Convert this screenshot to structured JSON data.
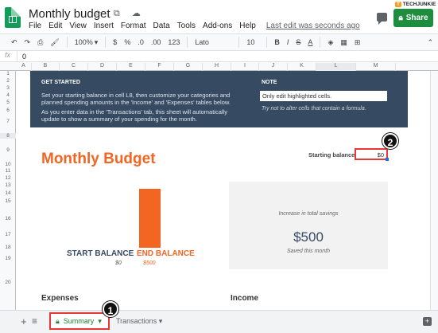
{
  "brand": {
    "prefix": "T",
    "name": "TECHJUNKIE"
  },
  "title": "Monthly budget",
  "title_icons": "☆ ⧉ ☁",
  "menu": [
    "File",
    "Edit",
    "View",
    "Insert",
    "Format",
    "Data",
    "Tools",
    "Add-ons",
    "Help"
  ],
  "last_edit": "Last edit was seconds ago",
  "share_label": "Share",
  "toolbar": {
    "zoom": "100%",
    "currency": "$",
    "percent": "%",
    "decimal_less": ".0",
    "decimal_more": ".00",
    "more_formats": "123",
    "font": "Lato",
    "font_size": "10",
    "bold": "B",
    "italic": "I",
    "strike": "S",
    "text_color": "A"
  },
  "formula_bar": {
    "fx": "fx",
    "value": "0"
  },
  "columns": [
    "A",
    "B",
    "C",
    "D",
    "E",
    "F",
    "G",
    "H",
    "I",
    "J",
    "K",
    "L",
    "M"
  ],
  "rows": [
    "1",
    "2",
    "3",
    "4",
    "5",
    "6",
    "7",
    "8",
    "9",
    "10",
    "11",
    "12",
    "13",
    "14",
    "15",
    "16",
    "17",
    "18",
    "19",
    "20"
  ],
  "banner": {
    "get_started_title": "GET STARTED",
    "get_started_text1": "Set your starting balance in cell L8, then customize your categories and planned spending amounts in the 'Income' and 'Expenses' tables below.",
    "get_started_text2": "As you enter data in the 'Transactions' tab, this sheet will automatically update to show a summary of your spending for the month.",
    "note_title": "NOTE",
    "note_box": "Only edit highlighted cells.",
    "note_italic": "Try not to alter cells that contain a formula."
  },
  "sheet": {
    "title": "Monthly Budget",
    "starting_balance_label": "Starting balance",
    "starting_balance_value": "$0",
    "start_balance_label": "START BALANCE",
    "start_balance_value": "$0",
    "end_balance_label": "END BALANCE",
    "end_balance_value": "$500",
    "savings_label": "Increase in total savings",
    "savings_value": "$500",
    "savings_sub": "Saved this month",
    "expenses_label": "Expenses",
    "income_label": "Income"
  },
  "tabs": {
    "active": "Summary",
    "other": "Transactions"
  },
  "badges": [
    "1",
    "2"
  ],
  "colors": {
    "accent_orange": "#f26522",
    "banner_navy": "#364a62",
    "share_green": "#1e8e3e",
    "highlight_red": "#e53935"
  }
}
